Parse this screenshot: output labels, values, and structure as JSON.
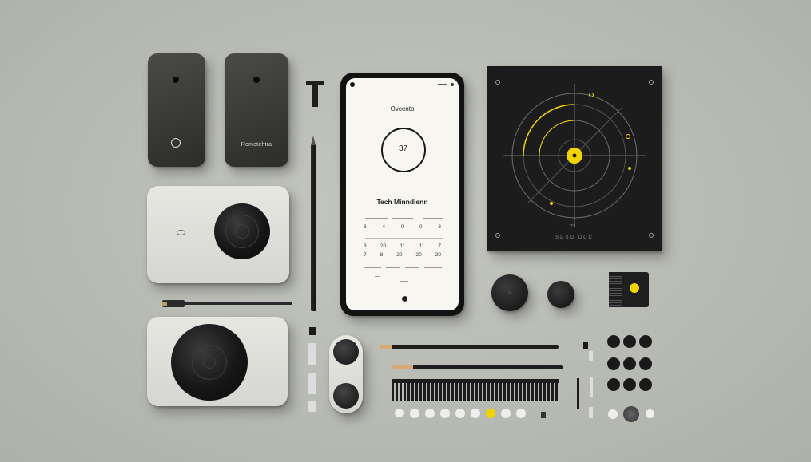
{
  "remote_right": {
    "label": "Remotehtra"
  },
  "phone": {
    "title": "Ovcento",
    "dial_value": "37",
    "subtitle": "Tech Minndienn",
    "calendar_row1": [
      "3",
      "4",
      "0",
      "0",
      "3"
    ],
    "calendar_row2": [
      "3",
      "20",
      "11",
      "11",
      "7"
    ],
    "calendar_row3": [
      "7",
      "8",
      "20",
      "20",
      "20"
    ]
  },
  "board": {
    "caption": "SDSG  DCC",
    "marker": "TS"
  },
  "colors": {
    "accent_yellow": "#f2d400",
    "background": "#b8bab4",
    "device_black": "#1c1c1c",
    "device_white": "#e5e5e0"
  }
}
